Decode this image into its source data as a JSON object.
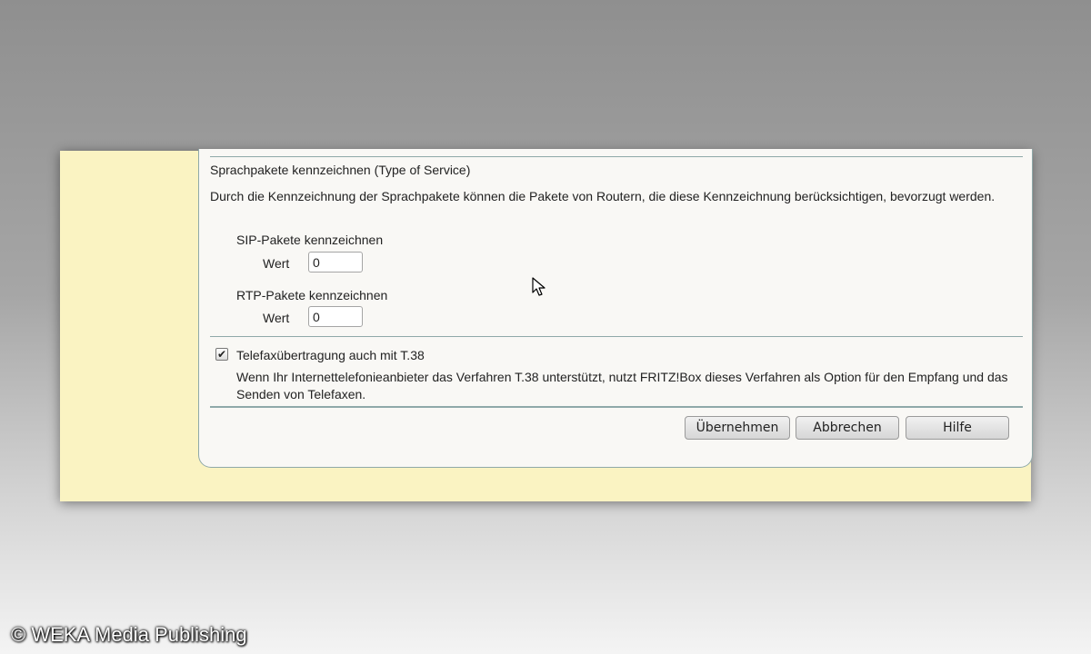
{
  "section": {
    "title": "Sprachpakete kennzeichnen (Type of Service)",
    "description": "Durch die Kennzeichnung der Sprachpakete können die Pakete von Routern, die diese Kennzeichnung berücksichtigen, bevorzugt werden."
  },
  "sip": {
    "label": "SIP-Pakete kennzeichnen",
    "field_label": "Wert",
    "value": "0"
  },
  "rtp": {
    "label": "RTP-Pakete kennzeichnen",
    "field_label": "Wert",
    "value": "0"
  },
  "fax": {
    "checked": true,
    "label": "Telefaxübertragung auch mit T.38",
    "description": "Wenn Ihr Internettelefonieanbieter das Verfahren T.38 unterstützt, nutzt FRITZ!Box dieses Verfahren als Option für den Empfang und das Senden von Telefaxen."
  },
  "buttons": {
    "apply": "Übernehmen",
    "cancel": "Abbrechen",
    "help": "Hilfe"
  },
  "watermark": "© WEKA Media Publishing",
  "colors": {
    "sidebar_background": "#faf3c2",
    "panel_background": "#f9f8f5",
    "divider": "#8fa9a9"
  }
}
